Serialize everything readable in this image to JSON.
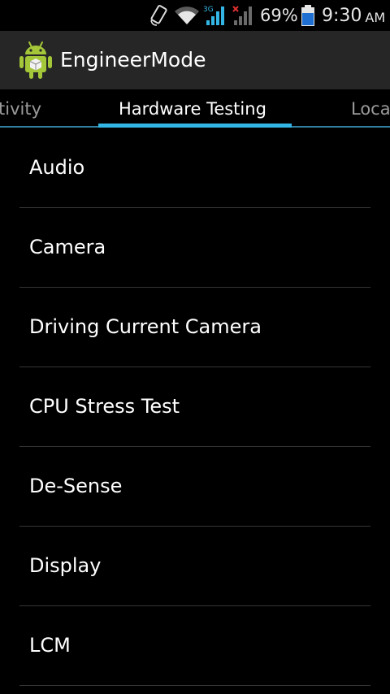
{
  "status_bar": {
    "battery_percent": "69%",
    "time": "9:30",
    "ampm": "AM",
    "network_label": "3G",
    "icons": [
      "screen-rotation-icon",
      "wifi-icon",
      "signal-3g-icon",
      "signal-no-sim-icon",
      "battery-icon"
    ],
    "battery_color": "#1e6fd1"
  },
  "action_bar": {
    "title": "EngineerMode",
    "icon": "android-robot-icon",
    "background": "#262626"
  },
  "tabs": [
    {
      "label": "tivity"
    },
    {
      "label": "Hardware Testing",
      "selected": true
    },
    {
      "label": "Loca"
    }
  ],
  "accent_color": "#33b5e5",
  "list": {
    "items": [
      {
        "label": "Audio"
      },
      {
        "label": "Camera"
      },
      {
        "label": "Driving Current Camera"
      },
      {
        "label": "CPU Stress Test"
      },
      {
        "label": "De-Sense"
      },
      {
        "label": "Display"
      },
      {
        "label": "LCM"
      }
    ]
  }
}
